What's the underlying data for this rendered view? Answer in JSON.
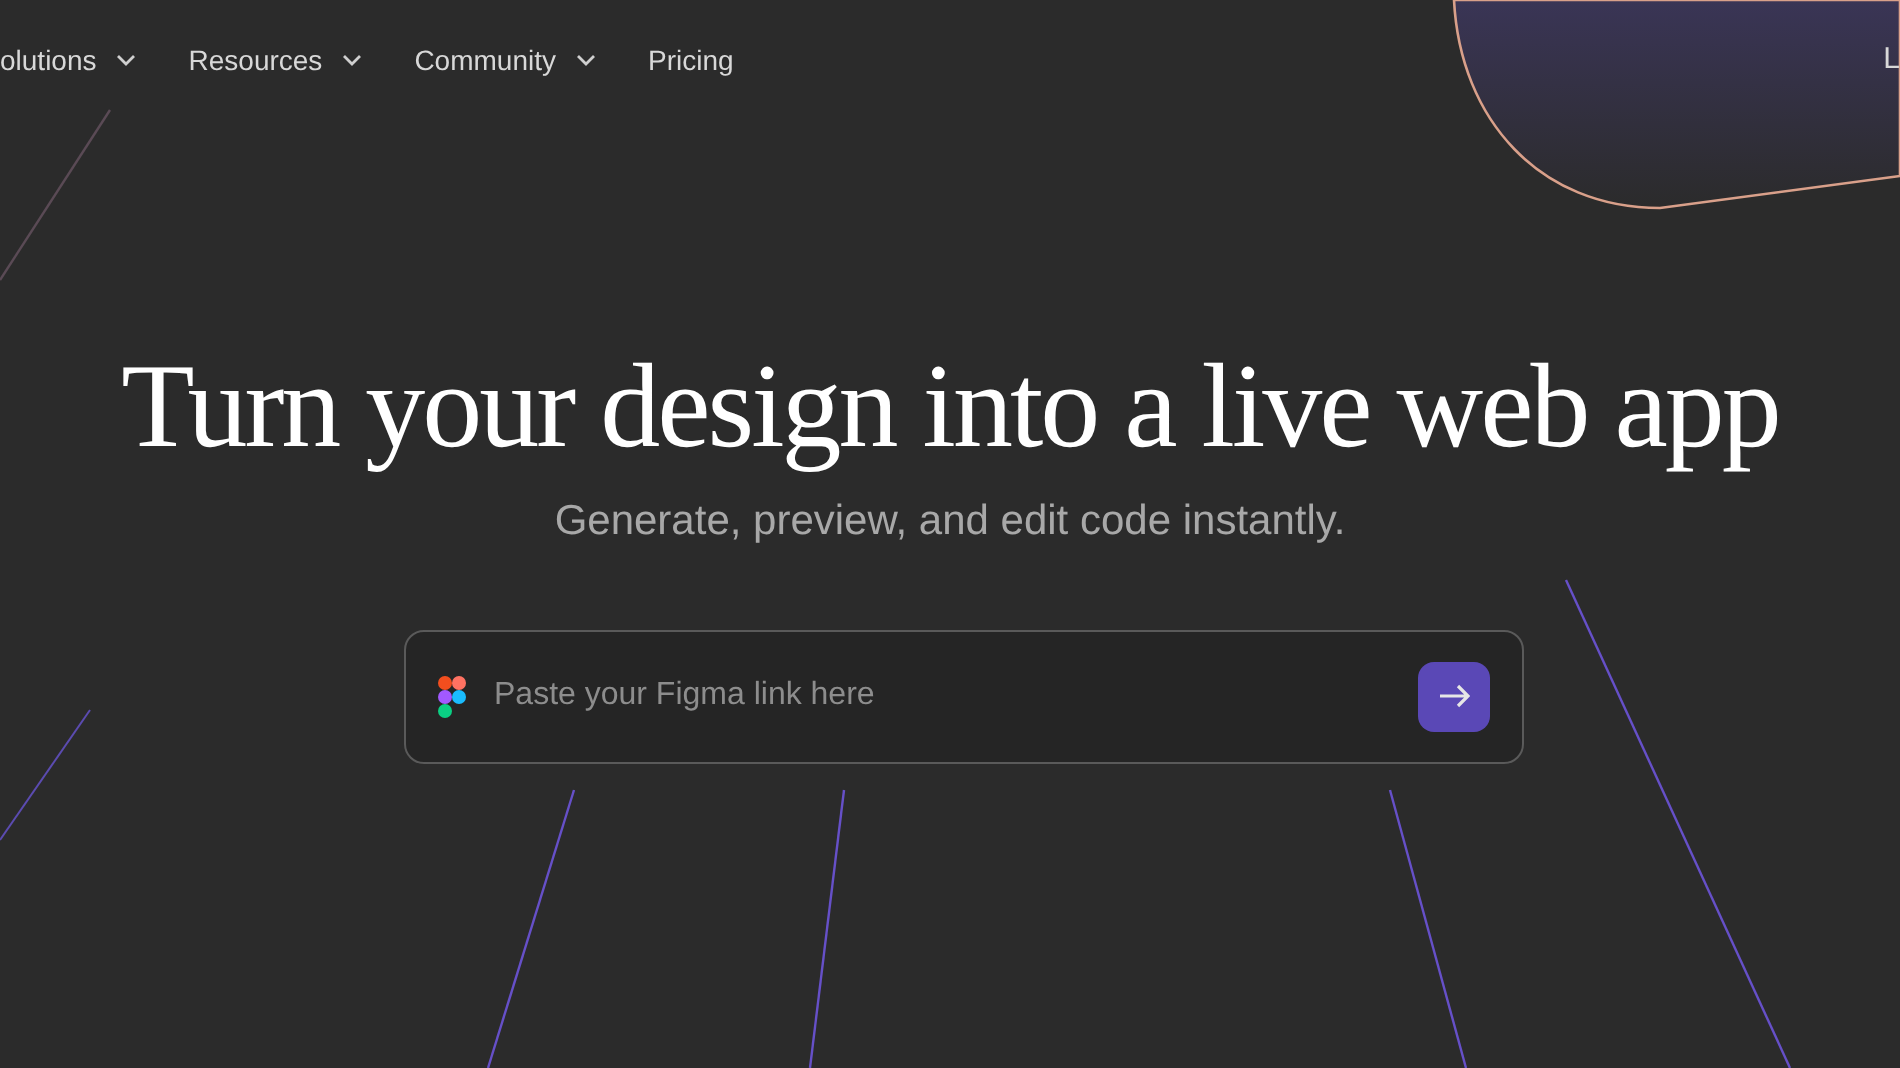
{
  "nav": [
    {
      "label": "olutions",
      "has_menu": true
    },
    {
      "label": "Resources",
      "has_menu": true
    },
    {
      "label": "Community",
      "has_menu": true
    },
    {
      "label": "Pricing",
      "has_menu": false
    }
  ],
  "nav_right": "L",
  "hero": {
    "title": "Turn your design into a live web app",
    "subtitle": "Generate, preview, and edit code instantly."
  },
  "link_field": {
    "placeholder": "Paste your Figma link here"
  }
}
